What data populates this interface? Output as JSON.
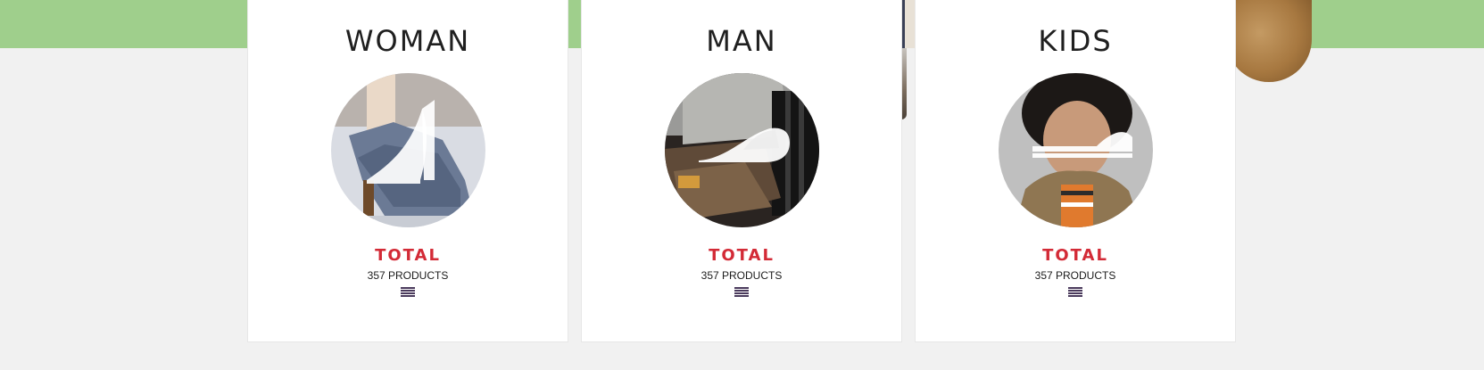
{
  "categories": [
    {
      "title": "WOMAN",
      "total_label": "TOTAL",
      "count_label": "357 PRODUCTS",
      "image_icon": "high-heel-shoe-icon",
      "menu_icon": "list-icon"
    },
    {
      "title": "MAN",
      "total_label": "TOTAL",
      "count_label": "357 PRODUCTS",
      "image_icon": "oxford-shoe-icon",
      "menu_icon": "list-icon"
    },
    {
      "title": "KIDS",
      "total_label": "TOTAL",
      "count_label": "357 PRODUCTS",
      "image_icon": "sneaker-icon",
      "menu_icon": "list-icon"
    }
  ],
  "colors": {
    "banner": "#9fcf8c",
    "page_background": "#f1f1f1",
    "card_background": "#ffffff",
    "total_accent": "#d32a36",
    "menu_icon": "#4a3a5c"
  }
}
